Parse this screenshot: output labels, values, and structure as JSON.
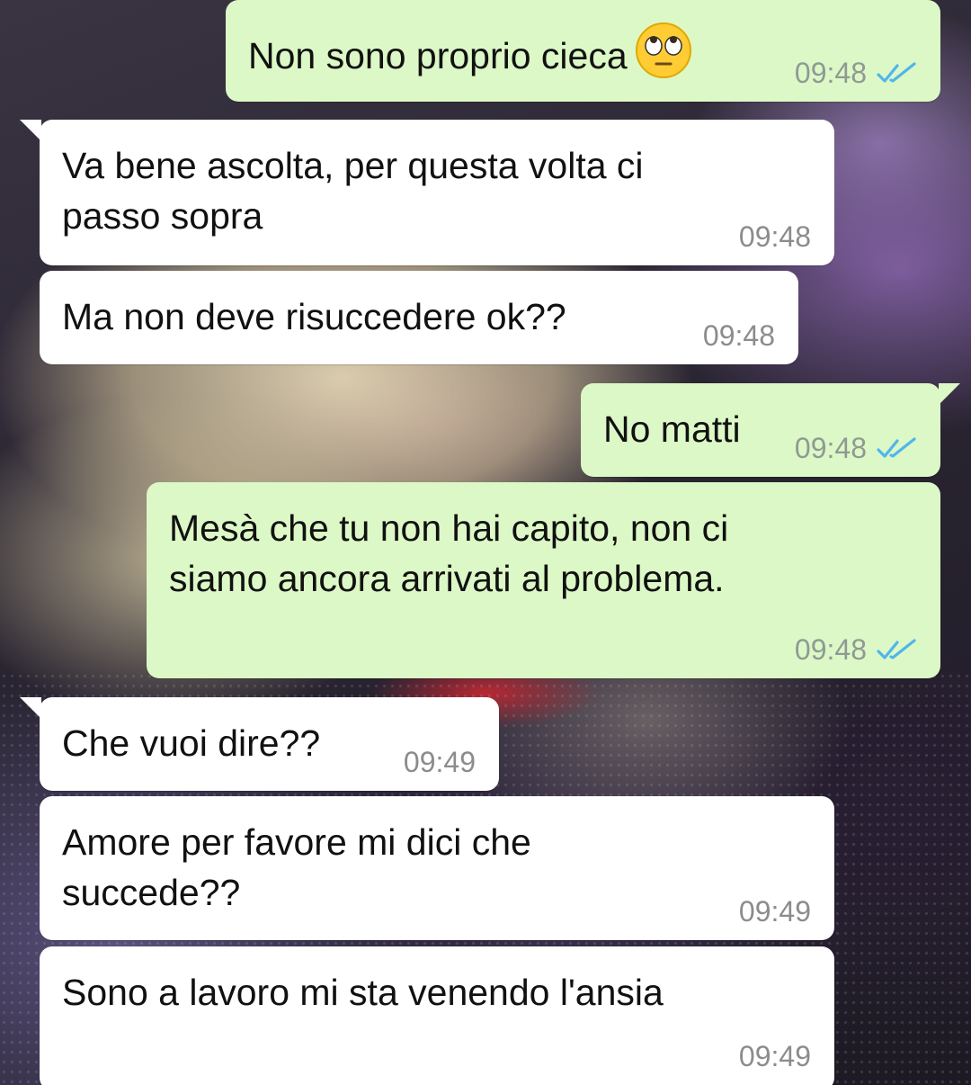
{
  "theme": {
    "incoming_bubble": "#ffffff",
    "outgoing_bubble": "#dcf8c6",
    "time_color": "#8c8c8c",
    "read_tick_color": "#4fb6ec"
  },
  "messages": [
    {
      "direction": "out",
      "text": "Non sono proprio cieca",
      "emoji": "face-with-rolling-eyes",
      "time": "09:48",
      "status": "read"
    },
    {
      "direction": "in",
      "text": "Va bene ascolta, per questa volta ci\npasso sopra",
      "time": "09:48"
    },
    {
      "direction": "in",
      "text": "Ma non deve risuccedere ok??",
      "time": "09:48"
    },
    {
      "direction": "out",
      "text": "No matti",
      "time": "09:48",
      "status": "read"
    },
    {
      "direction": "out",
      "text": "Mesà che tu non hai capito, non ci\nsiamo ancora arrivati al problema.",
      "time": "09:48",
      "status": "read"
    },
    {
      "direction": "in",
      "text": "Che vuoi dire??",
      "time": "09:49"
    },
    {
      "direction": "in",
      "text": "Amore per favore mi dici che\nsuccede??",
      "time": "09:49"
    },
    {
      "direction": "in",
      "text": "Sono a lavoro mi sta venendo l'ansia",
      "time": "09:49"
    }
  ]
}
